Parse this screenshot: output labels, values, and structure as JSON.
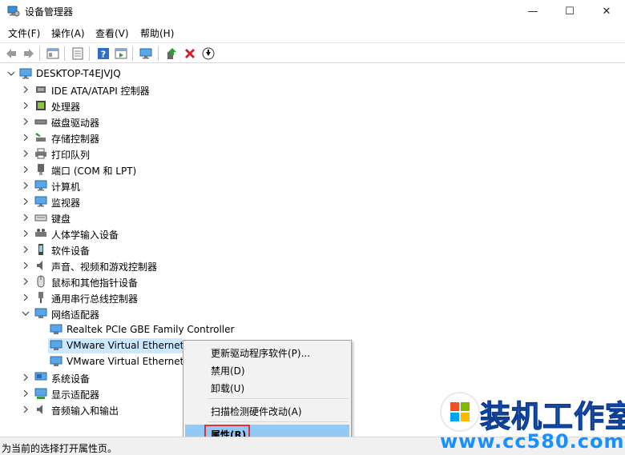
{
  "window": {
    "title": "设备管理器",
    "min_glyph": "—",
    "max_glyph": "☐",
    "close_glyph": "✕"
  },
  "menu": [
    "文件(F)",
    "操作(A)",
    "查看(V)",
    "帮助(H)"
  ],
  "tree": {
    "root": "DESKTOP-T4EJVJQ",
    "items": [
      {
        "label": "IDE ATA/ATAPI 控制器",
        "icon": "ide-controller-icon"
      },
      {
        "label": "处理器",
        "icon": "processor-icon"
      },
      {
        "label": "磁盘驱动器",
        "icon": "disk-drive-icon"
      },
      {
        "label": "存储控制器",
        "icon": "storage-controller-icon"
      },
      {
        "label": "打印队列",
        "icon": "printer-icon"
      },
      {
        "label": "端口 (COM 和 LPT)",
        "icon": "port-icon"
      },
      {
        "label": "计算机",
        "icon": "computer-icon"
      },
      {
        "label": "监视器",
        "icon": "monitor-icon"
      },
      {
        "label": "键盘",
        "icon": "keyboard-icon"
      },
      {
        "label": "人体学输入设备",
        "icon": "hid-icon"
      },
      {
        "label": "软件设备",
        "icon": "software-device-icon"
      },
      {
        "label": "声音、视频和游戏控制器",
        "icon": "sound-icon"
      },
      {
        "label": "鼠标和其他指针设备",
        "icon": "mouse-icon"
      },
      {
        "label": "通用串行总线控制器",
        "icon": "usb-icon"
      },
      {
        "label": "网络适配器",
        "icon": "network-adapter-icon",
        "expanded": true
      },
      {
        "label": "Realtek PCIe GBE Family Controller",
        "icon": "network-adapter-icon",
        "child": true
      },
      {
        "label": "VMware Virtual Ethernet",
        "icon": "network-adapter-icon",
        "child": true,
        "selected": true
      },
      {
        "label": "VMware Virtual Ethernet",
        "icon": "network-adapter-icon",
        "child": true
      },
      {
        "label": "系统设备",
        "icon": "system-device-icon"
      },
      {
        "label": "显示适配器",
        "icon": "display-adapter-icon"
      },
      {
        "label": "音频输入和输出",
        "icon": "audio-io-icon"
      }
    ]
  },
  "context_menu": [
    {
      "label": "更新驱动程序软件(P)..."
    },
    {
      "label": "禁用(D)"
    },
    {
      "label": "卸载(U)"
    },
    {
      "label": "扫描检测硬件改动(A)"
    },
    {
      "label": "属性(R)",
      "highlighted": true
    }
  ],
  "status": "为当前的选择打开属性页。",
  "watermark": {
    "title": "装机工作室",
    "url": "www.cc580.com"
  },
  "colors": {
    "selection": "#cce8ff",
    "menu_highlight": "#91c9f7",
    "highlight_box": "#e0303a",
    "watermark_blue": "#1b62d4"
  }
}
